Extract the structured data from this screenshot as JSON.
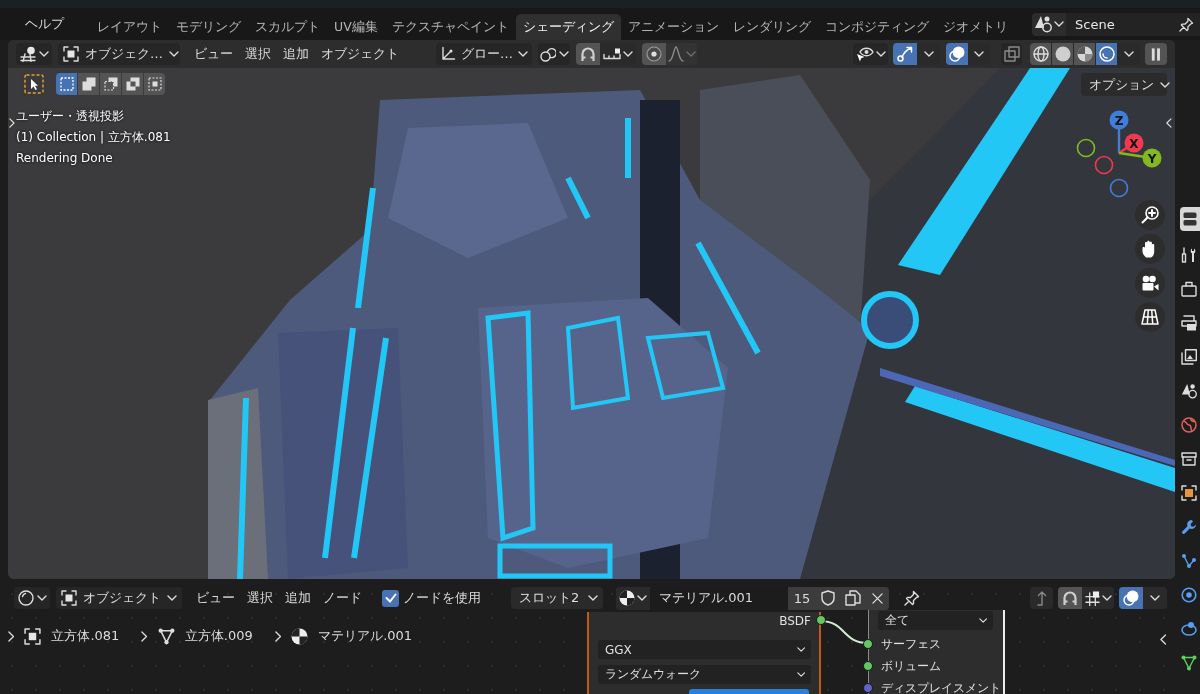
{
  "menu_bar": {
    "menus": [
      "ヘルプ"
    ]
  },
  "workspaces": [
    {
      "label": "レイアウト",
      "selected": false
    },
    {
      "label": "モデリング",
      "selected": false
    },
    {
      "label": "スカルプト",
      "selected": false
    },
    {
      "label": "UV編集",
      "selected": false
    },
    {
      "label": "テクスチャペイント",
      "selected": false
    },
    {
      "label": "シェーディング",
      "selected": true
    },
    {
      "label": "アニメーション",
      "selected": false
    },
    {
      "label": "レンダリング",
      "selected": false
    },
    {
      "label": "コンポジティング",
      "selected": false
    },
    {
      "label": "ジオメトリ",
      "selected": false
    }
  ],
  "scene": {
    "name": "Scene"
  },
  "viewport": {
    "header": {
      "mode": "オブジェク…",
      "menus": [
        "ビュー",
        "選択",
        "追加",
        "オブジェクト"
      ],
      "orientation": "グロー…",
      "gizmos": {
        "on": true
      },
      "overlays": {
        "on": true
      },
      "xray": {
        "on": false
      },
      "shading_modes": [
        {
          "selected": false
        },
        {
          "selected": false
        },
        {
          "selected": false
        },
        {
          "selected": true
        }
      ]
    },
    "select_modes": [
      {
        "selected": true
      },
      {
        "selected": false
      },
      {
        "selected": false
      },
      {
        "selected": false
      },
      {
        "selected": false
      }
    ],
    "options": "オプション",
    "overlay_text": [
      "ユーザー・透視投影",
      "(1) Collection | 立方体.081",
      "Rendering Done"
    ],
    "gizmo_axes": [
      "Z",
      "X",
      "Y"
    ]
  },
  "node_editor": {
    "header": {
      "mode": "オブジェクト",
      "menus": [
        "ビュー",
        "選択",
        "追加",
        "ノード"
      ],
      "use_nodes": {
        "label": "ノードを使用",
        "checked": true
      },
      "slot": "スロット2",
      "material": "マテリアル.001",
      "users": "15",
      "overlays": {
        "on": true
      }
    },
    "breadcrumbs": [
      "立方体.081",
      "立方体.009",
      "マテリアル.001"
    ],
    "bsdf_node": {
      "output": "BSDF",
      "dropdowns": [
        "GGX",
        "ランダムウォーク"
      ]
    },
    "output_node": {
      "target": "全て",
      "inputs": [
        {
          "label": "サーフェス",
          "color": "#63c763"
        },
        {
          "label": "ボリューム",
          "color": "#63c763"
        },
        {
          "label": "ディスプレイスメント",
          "color": "#6363c7"
        }
      ]
    }
  }
}
